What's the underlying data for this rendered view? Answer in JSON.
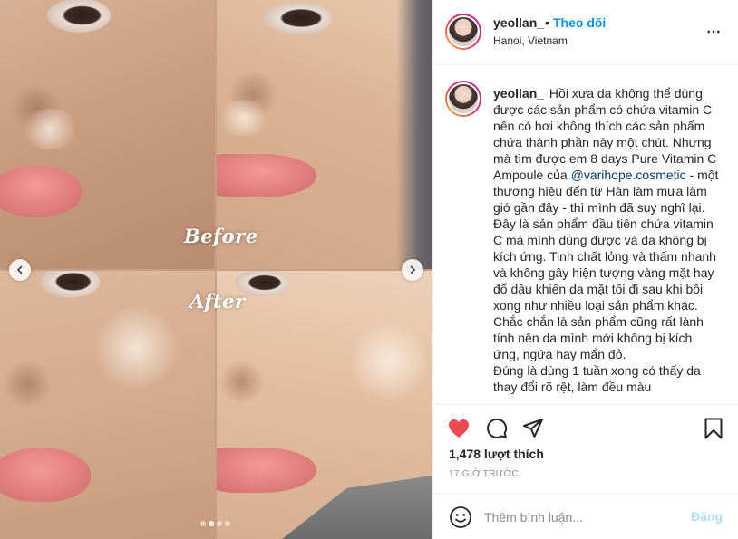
{
  "media": {
    "before_label": "Before",
    "after_label": "After",
    "carousel_dots": 4,
    "active_dot": 2
  },
  "header": {
    "username": "yeollan_",
    "separator": "•",
    "follow_label": "Theo dõi",
    "location": "Hanoi, Vietnam",
    "more_icon": "⋯"
  },
  "caption": {
    "username": "yeollan_",
    "text_part1": "Hồi xưa da không thể dùng được các sản phẩm có chứa vitamin C nên có hơi không thích các sản phẩm chứa thành phần này một chút. Nhưng mà tìm được em 8 days Pure Vitamin C Ampoule của ",
    "mention": "@varihope.cosmetic",
    "text_part2": " - một thương hiệu đến từ Hàn làm mưa làm gió gần đây - thì mình đã suy nghĩ lại.\nĐây là sản phẩm đầu tiên chứa vitamin C mà mình dùng được và da không bị kích ứng. Tinh chất lỏng và thấm nhanh và không gây hiện tượng vàng mặt hay đổ dầu khiến da mặt tối đi sau khi bôi xong như nhiều loại sản phẩm khác. Chắc chắn là sản phẩm cũng rất lành tính nên da mình mới không bị kích ứng, ngứa hay mẩn đỏ.\nĐúng là dùng 1 tuần xong có thấy da thay đổi rõ rệt, làm đều màu"
  },
  "actions": {
    "likes": "1,478 lượt thích",
    "time_ago": "17 GIỜ TRƯỚC",
    "heart_color": "#ed4956"
  },
  "comment": {
    "placeholder": "Thêm bình luận...",
    "post_label": "Đăng",
    "post_color": "#b2dffc"
  },
  "icons": {
    "prev": "chevron-left-icon",
    "next": "chevron-right-icon",
    "like": "heart-icon",
    "comment": "comment-icon",
    "share": "share-icon",
    "save": "bookmark-icon",
    "emoji": "emoji-icon"
  }
}
